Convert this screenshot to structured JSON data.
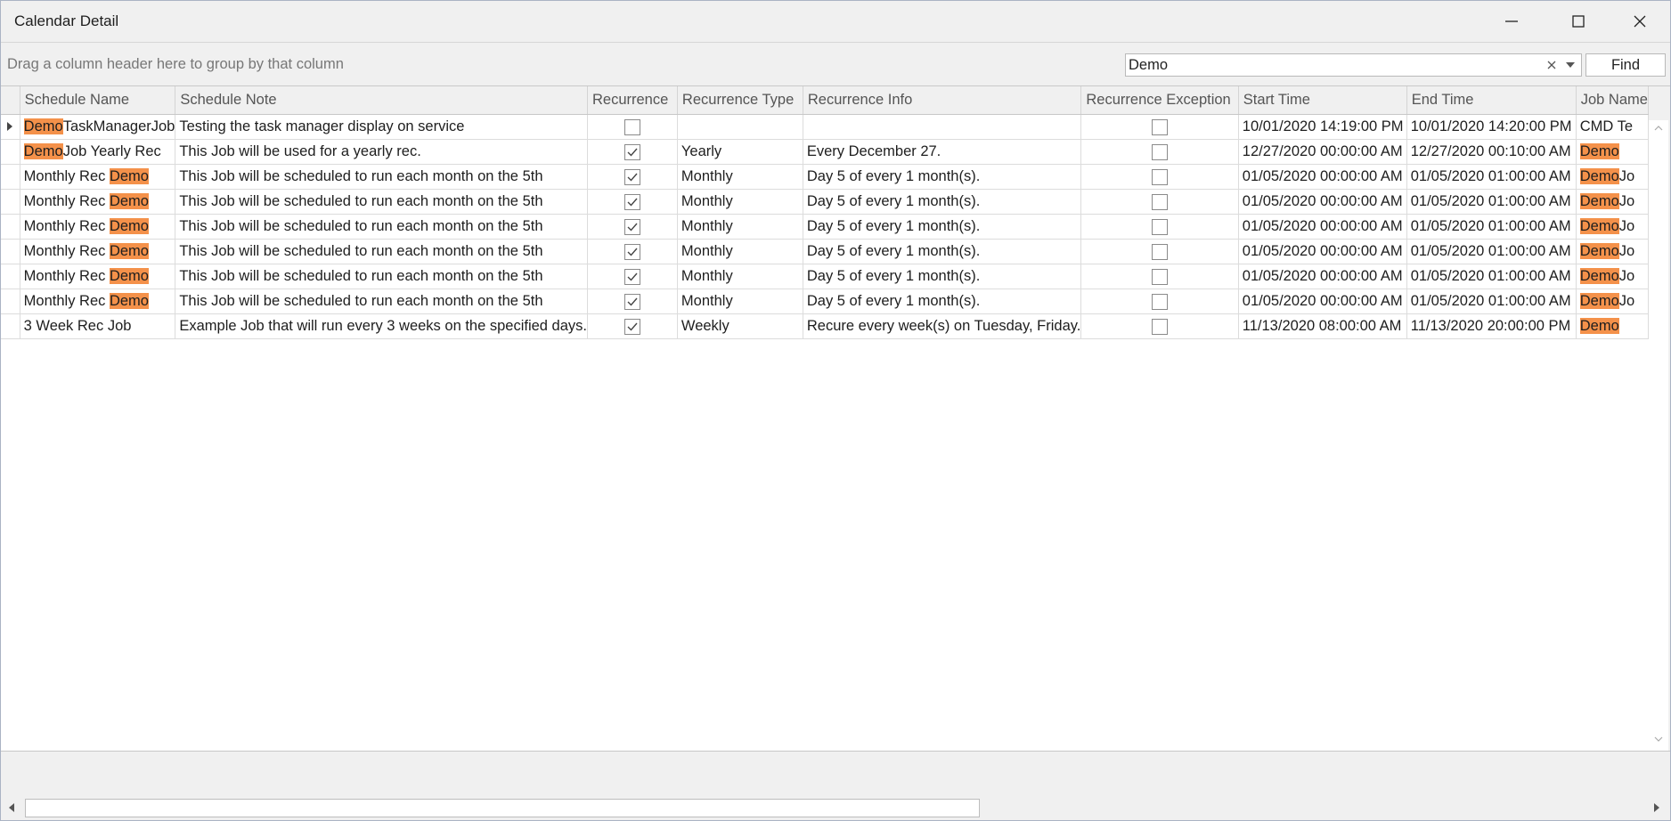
{
  "window": {
    "title": "Calendar Detail"
  },
  "group_panel": {
    "hint": "Drag a column header here to group by that column"
  },
  "find": {
    "value": "Demo",
    "button_label": "Find"
  },
  "grid": {
    "columns": [
      "Schedule Name",
      "Schedule Note",
      "Recurrence",
      "Recurrence Type",
      "Recurrence Info",
      "Recurrence Exception",
      "Start Time",
      "End Time",
      "Job Name"
    ],
    "rows": [
      {
        "name_pre": "",
        "name_hl": "Demo",
        "name_post": "TaskManagerJob",
        "note": "Testing the task manager display on service",
        "recurrence": false,
        "type": "",
        "info": "",
        "exception": false,
        "start": "10/01/2020 14:19:00 PM",
        "end": "10/01/2020 14:20:00 PM",
        "job_hl": "",
        "job_rest": "CMD Te"
      },
      {
        "name_pre": "",
        "name_hl": "Demo",
        "name_post": "Job Yearly Rec",
        "note": "This Job will be used for a yearly rec.",
        "recurrence": true,
        "type": "Yearly",
        "info": "Every December 27.",
        "exception": false,
        "start": "12/27/2020 00:00:00 AM",
        "end": "12/27/2020 00:10:00 AM",
        "job_hl": "Demo",
        "job_rest": ""
      },
      {
        "name_pre": "Monthly Rec ",
        "name_hl": "Demo",
        "name_post": "",
        "note": "This Job will be scheduled to run each month on the 5th",
        "recurrence": true,
        "type": "Monthly",
        "info": "Day 5 of every 1 month(s).",
        "exception": false,
        "start": "01/05/2020 00:00:00 AM",
        "end": "01/05/2020 01:00:00 AM",
        "job_hl": "Demo",
        "job_rest": "Jo"
      },
      {
        "name_pre": "Monthly Rec ",
        "name_hl": "Demo",
        "name_post": "",
        "note": "This Job will be scheduled to run each month on the 5th",
        "recurrence": true,
        "type": "Monthly",
        "info": "Day 5 of every 1 month(s).",
        "exception": false,
        "start": "01/05/2020 00:00:00 AM",
        "end": "01/05/2020 01:00:00 AM",
        "job_hl": "Demo",
        "job_rest": "Jo"
      },
      {
        "name_pre": "Monthly Rec ",
        "name_hl": "Demo",
        "name_post": "",
        "note": "This Job will be scheduled to run each month on the 5th",
        "recurrence": true,
        "type": "Monthly",
        "info": "Day 5 of every 1 month(s).",
        "exception": false,
        "start": "01/05/2020 00:00:00 AM",
        "end": "01/05/2020 01:00:00 AM",
        "job_hl": "Demo",
        "job_rest": "Jo"
      },
      {
        "name_pre": "Monthly Rec ",
        "name_hl": "Demo",
        "name_post": "",
        "note": "This Job will be scheduled to run each month on the 5th",
        "recurrence": true,
        "type": "Monthly",
        "info": "Day 5 of every 1 month(s).",
        "exception": false,
        "start": "01/05/2020 00:00:00 AM",
        "end": "01/05/2020 01:00:00 AM",
        "job_hl": "Demo",
        "job_rest": "Jo"
      },
      {
        "name_pre": "Monthly Rec ",
        "name_hl": "Demo",
        "name_post": "",
        "note": "This Job will be scheduled to run each month on the 5th",
        "recurrence": true,
        "type": "Monthly",
        "info": "Day 5 of every 1 month(s).",
        "exception": false,
        "start": "01/05/2020 00:00:00 AM",
        "end": "01/05/2020 01:00:00 AM",
        "job_hl": "Demo",
        "job_rest": "Jo"
      },
      {
        "name_pre": "Monthly Rec ",
        "name_hl": "Demo",
        "name_post": "",
        "note": "This Job will be scheduled to run each month on the 5th",
        "recurrence": true,
        "type": "Monthly",
        "info": "Day 5 of every 1 month(s).",
        "exception": false,
        "start": "01/05/2020 00:00:00 AM",
        "end": "01/05/2020 01:00:00 AM",
        "job_hl": "Demo",
        "job_rest": "Jo"
      },
      {
        "name_pre": "3 Week Rec Job",
        "name_hl": "",
        "name_post": "",
        "note": "Example Job that will run every 3 weeks on the specified days.",
        "recurrence": true,
        "type": "Weekly",
        "info": "Recure every week(s) on Tuesday, Friday.",
        "exception": false,
        "start": "11/13/2020 08:00:00 AM",
        "end": "11/13/2020 20:00:00 PM",
        "job_hl": "Demo",
        "job_rest": ""
      }
    ]
  },
  "colors": {
    "highlight": "#f4914a",
    "header_bg": "#f0f0f0"
  },
  "icons": {
    "minimize": "minimize-icon",
    "maximize": "maximize-icon",
    "close": "close-icon",
    "clear": "clear-icon",
    "dropdown": "chevron-down-icon",
    "row_indicator": "triangle-right-icon",
    "check": "check-icon"
  }
}
